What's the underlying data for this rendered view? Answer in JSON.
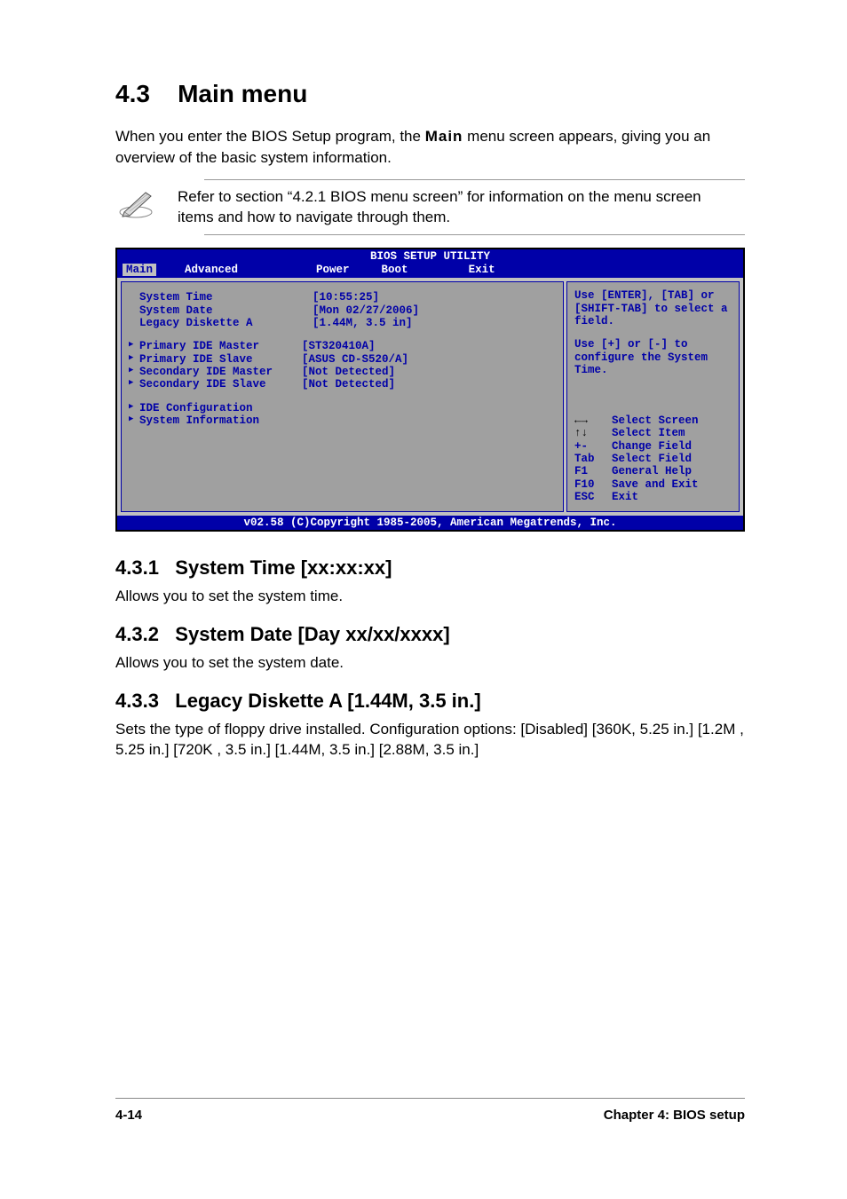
{
  "heading_number": "4.3",
  "heading_title": "Main menu",
  "intro_part1": "When you enter the BIOS Setup program, the ",
  "intro_main": "Main",
  "intro_part2": " menu screen appears, giving you an overview of the basic system information.",
  "note": "Refer to section “4.2.1  BIOS menu screen” for information on the menu screen items and how to navigate through them.",
  "bios": {
    "title": "BIOS SETUP UTILITY",
    "tabs": [
      "Main",
      "Advanced",
      "Power",
      "Boot",
      "Exit"
    ],
    "items": [
      {
        "label": "System Time",
        "value": "[10:55:25]",
        "arrow": false
      },
      {
        "label": "System Date",
        "value": "[Mon 02/27/2006]",
        "arrow": false
      },
      {
        "label": "Legacy Diskette A",
        "value": "[1.44M, 3.5 in]",
        "arrow": false
      }
    ],
    "items2": [
      {
        "label": "Primary IDE Master",
        "value": "[ST320410A]",
        "arrow": true
      },
      {
        "label": "Primary IDE Slave",
        "value": "[ASUS CD-S520/A]",
        "arrow": true
      },
      {
        "label": "Secondary IDE Master",
        "value": "[Not Detected]",
        "arrow": true
      },
      {
        "label": "Secondary IDE Slave",
        "value": "[Not Detected]",
        "arrow": true
      }
    ],
    "items3": [
      {
        "label": "IDE Configuration",
        "value": "",
        "arrow": true
      },
      {
        "label": "System Information",
        "value": "",
        "arrow": true
      }
    ],
    "help1": "Use [ENTER], [TAB] or [SHIFT-TAB] to select a field.",
    "help2": "Use [+] or [-] to configure the System Time.",
    "nav": [
      {
        "key": "←→",
        "desc": "Select Screen",
        "black": true
      },
      {
        "key": "↑↓",
        "desc": "Select Item",
        "black": true
      },
      {
        "key": "+-",
        "desc": "Change Field",
        "black": false
      },
      {
        "key": "Tab",
        "desc": "Select Field",
        "black": false
      },
      {
        "key": "F1",
        "desc": "General Help",
        "black": false
      },
      {
        "key": "F10",
        "desc": "Save and Exit",
        "black": false
      },
      {
        "key": "ESC",
        "desc": "Exit",
        "black": false
      }
    ],
    "footer": "v02.58 (C)Copyright 1985-2005, American Megatrends, Inc."
  },
  "sections": [
    {
      "num": "4.3.1",
      "title": "System Time [xx:xx:xx]",
      "body": "Allows you to set the system time."
    },
    {
      "num": "4.3.2",
      "title": "System Date [Day xx/xx/xxxx]",
      "body": "Allows you to set the system date."
    },
    {
      "num": "4.3.3",
      "title": "Legacy Diskette A [1.44M, 3.5 in.]",
      "body": "Sets the type of floppy drive installed. Configuration options: [Disabled] [360K, 5.25 in.] [1.2M , 5.25 in.] [720K , 3.5 in.] [1.44M, 3.5 in.] [2.88M, 3.5 in.]"
    }
  ],
  "page_footer_left": "4-14",
  "page_footer_right": "Chapter 4: BIOS setup"
}
